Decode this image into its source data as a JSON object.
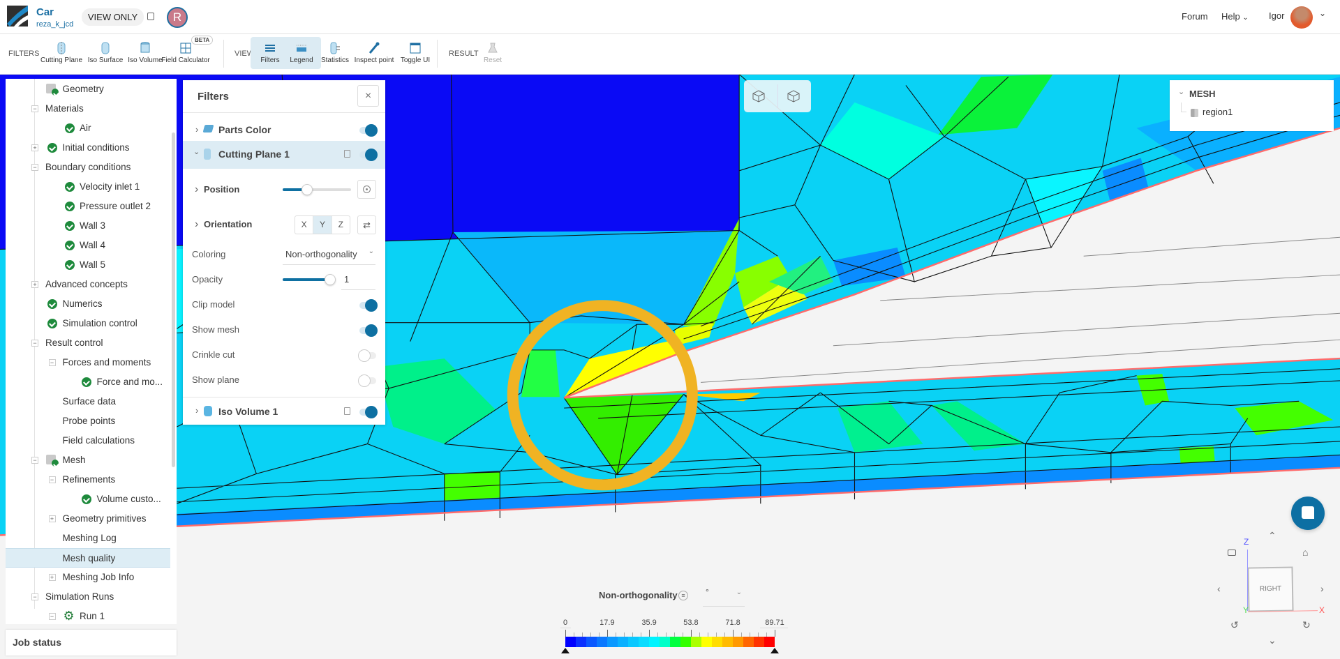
{
  "header": {
    "project_title": "Car",
    "project_owner": "reza_k_jcd",
    "view_mode": "VIEW ONLY",
    "avatar_initial": "R",
    "nav": {
      "forum": "Forum",
      "help": "Help",
      "user": "Igor"
    }
  },
  "toolbar": {
    "filters_label": "FILTERS",
    "view_label": "VIEW",
    "result_label": "RESULT",
    "beta_badge": "BETA",
    "buttons": [
      {
        "label": "Cutting Plane",
        "icon": "cutting-plane-icon",
        "active": false
      },
      {
        "label": "Iso Surface",
        "icon": "iso-surface-icon",
        "active": false
      },
      {
        "label": "Iso Volume",
        "icon": "iso-volume-icon",
        "active": false
      },
      {
        "label": "Field Calculator",
        "icon": "field-calculator-icon",
        "active": false
      },
      {
        "label": "Filters",
        "icon": "filters-icon",
        "active": true
      },
      {
        "label": "Legend",
        "icon": "legend-icon",
        "active": true
      },
      {
        "label": "Statistics",
        "icon": "statistics-icon",
        "active": false
      },
      {
        "label": "Inspect point",
        "icon": "inspect-point-icon",
        "active": false
      },
      {
        "label": "Toggle UI",
        "icon": "toggle-ui-icon",
        "active": false
      },
      {
        "label": "Reset",
        "icon": "reset-icon",
        "active": false,
        "disabled": true
      }
    ]
  },
  "sidebar": {
    "items": [
      {
        "label": "Geometry",
        "depth": 0,
        "expander": "",
        "icon": "geometry"
      },
      {
        "label": "Materials",
        "depth": 0,
        "expander": "-",
        "icon": ""
      },
      {
        "label": "Air",
        "depth": 1,
        "expander": "",
        "icon": "check"
      },
      {
        "label": "Initial conditions",
        "depth": 0,
        "expander": "+",
        "icon": "check"
      },
      {
        "label": "Boundary conditions",
        "depth": 0,
        "expander": "-",
        "icon": ""
      },
      {
        "label": "Velocity inlet 1",
        "depth": 1,
        "expander": "",
        "icon": "check"
      },
      {
        "label": "Pressure outlet 2",
        "depth": 1,
        "expander": "",
        "icon": "check"
      },
      {
        "label": "Wall 3",
        "depth": 1,
        "expander": "",
        "icon": "check"
      },
      {
        "label": "Wall 4",
        "depth": 1,
        "expander": "",
        "icon": "check"
      },
      {
        "label": "Wall 5",
        "depth": 1,
        "expander": "",
        "icon": "check"
      },
      {
        "label": "Advanced concepts",
        "depth": 0,
        "expander": "+",
        "icon": ""
      },
      {
        "label": "Numerics",
        "depth": 0,
        "expander": "",
        "icon": "check"
      },
      {
        "label": "Simulation control",
        "depth": 0,
        "expander": "",
        "icon": "check"
      },
      {
        "label": "Result control",
        "depth": 0,
        "expander": "-",
        "icon": ""
      },
      {
        "label": "Forces and moments",
        "depth": 1,
        "expander": "-",
        "icon": ""
      },
      {
        "label": "Force and mo...",
        "depth": 2,
        "expander": "",
        "icon": "check"
      },
      {
        "label": "Surface data",
        "depth": 1,
        "expander": "",
        "icon": ""
      },
      {
        "label": "Probe points",
        "depth": 1,
        "expander": "",
        "icon": ""
      },
      {
        "label": "Field calculations",
        "depth": 1,
        "expander": "",
        "icon": ""
      },
      {
        "label": "Mesh",
        "depth": 0,
        "expander": "-",
        "icon": "mesh"
      },
      {
        "label": "Refinements",
        "depth": 1,
        "expander": "-",
        "icon": ""
      },
      {
        "label": "Volume custo...",
        "depth": 2,
        "expander": "",
        "icon": "check"
      },
      {
        "label": "Geometry primitives",
        "depth": 1,
        "expander": "+",
        "icon": ""
      },
      {
        "label": "Meshing Log",
        "depth": 1,
        "expander": "",
        "icon": ""
      },
      {
        "label": "Mesh quality",
        "depth": 1,
        "expander": "",
        "icon": "",
        "selected": true
      },
      {
        "label": "Meshing Job Info",
        "depth": 1,
        "expander": "+",
        "icon": ""
      },
      {
        "label": "Simulation Runs",
        "depth": 0,
        "expander": "-",
        "icon": ""
      },
      {
        "label": "Run 1",
        "depth": 1,
        "expander": "-",
        "icon": "gear"
      }
    ],
    "job_status": "Job status"
  },
  "filters_panel": {
    "title": "Filters",
    "parts_color": {
      "label": "Parts Color",
      "enabled": true
    },
    "cutting_plane": {
      "label": "Cutting Plane 1",
      "enabled": true,
      "position_label": "Position",
      "position_value": 0.36,
      "orientation_label": "Orientation",
      "orientation_options": [
        "X",
        "Y",
        "Z"
      ],
      "orientation_selected": "Y",
      "coloring_label": "Coloring",
      "coloring_value": "Non-orthogonality",
      "opacity_label": "Opacity",
      "opacity_value": "1",
      "clip_model_label": "Clip model",
      "clip_model": true,
      "show_mesh_label": "Show mesh",
      "show_mesh": true,
      "crinkle_cut_label": "Crinkle cut",
      "crinkle_cut": false,
      "show_plane_label": "Show plane",
      "show_plane": false
    },
    "iso_volume": {
      "label": "Iso Volume 1",
      "enabled": true
    }
  },
  "mesh_panel": {
    "title": "MESH",
    "items": [
      "region1"
    ]
  },
  "legend": {
    "title": "Non-orthogonality",
    "unit": "°",
    "ticks": [
      "0",
      "17.9",
      "35.9",
      "53.8",
      "71.8",
      "89.71"
    ],
    "min": 0,
    "max": 89.71,
    "colors": [
      "#0000ff",
      "#0a30ff",
      "#0a58ff",
      "#0a78ff",
      "#0a98ff",
      "#0ab0ff",
      "#0ac8ff",
      "#0adcff",
      "#00f4ff",
      "#00ffc8",
      "#00ff40",
      "#33ff00",
      "#aaff00",
      "#ffff00",
      "#ffdd00",
      "#ffbb00",
      "#ff9900",
      "#ff6600",
      "#ff3300",
      "#ff0000"
    ]
  },
  "nav_cube": {
    "face": "RIGHT",
    "x": "X",
    "y": "Y",
    "z": "Z"
  },
  "colors": {
    "accent": "#0e70a2",
    "highlight_ring": "#f0b323",
    "selected_row": "#ddedf5"
  }
}
